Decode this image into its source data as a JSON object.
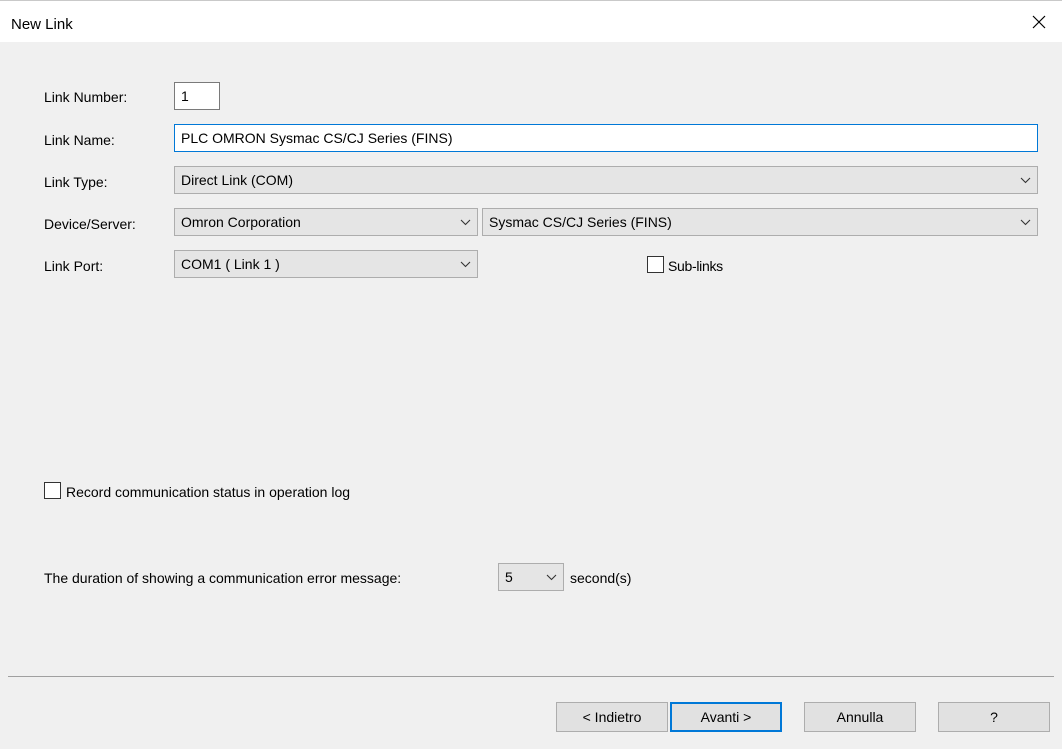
{
  "window": {
    "title": "New Link"
  },
  "form": {
    "link_number_label": "Link Number:",
    "link_number_value": "1",
    "link_name_label": "Link Name:",
    "link_name_value": "PLC OMRON Sysmac CS/CJ Series (FINS)",
    "link_type_label": "Link Type:",
    "link_type_value": "Direct Link (COM)",
    "device_server_label": "Device/Server:",
    "manufacturer_value": "Omron Corporation",
    "device_value": "Sysmac CS/CJ Series (FINS)",
    "link_port_label": "Link Port:",
    "link_port_value": "COM1 ( Link 1 )",
    "sublinks_label": "Sub-links",
    "record_status_label": "Record communication status in operation log",
    "duration_label": "The duration of showing a communication error message:",
    "duration_value": "5",
    "duration_unit": "second(s)"
  },
  "buttons": {
    "back": "< Indietro",
    "next": "Avanti >",
    "cancel": "Annulla",
    "help": "?"
  },
  "state": {
    "sublinks_checked": false,
    "record_status_checked": false
  }
}
